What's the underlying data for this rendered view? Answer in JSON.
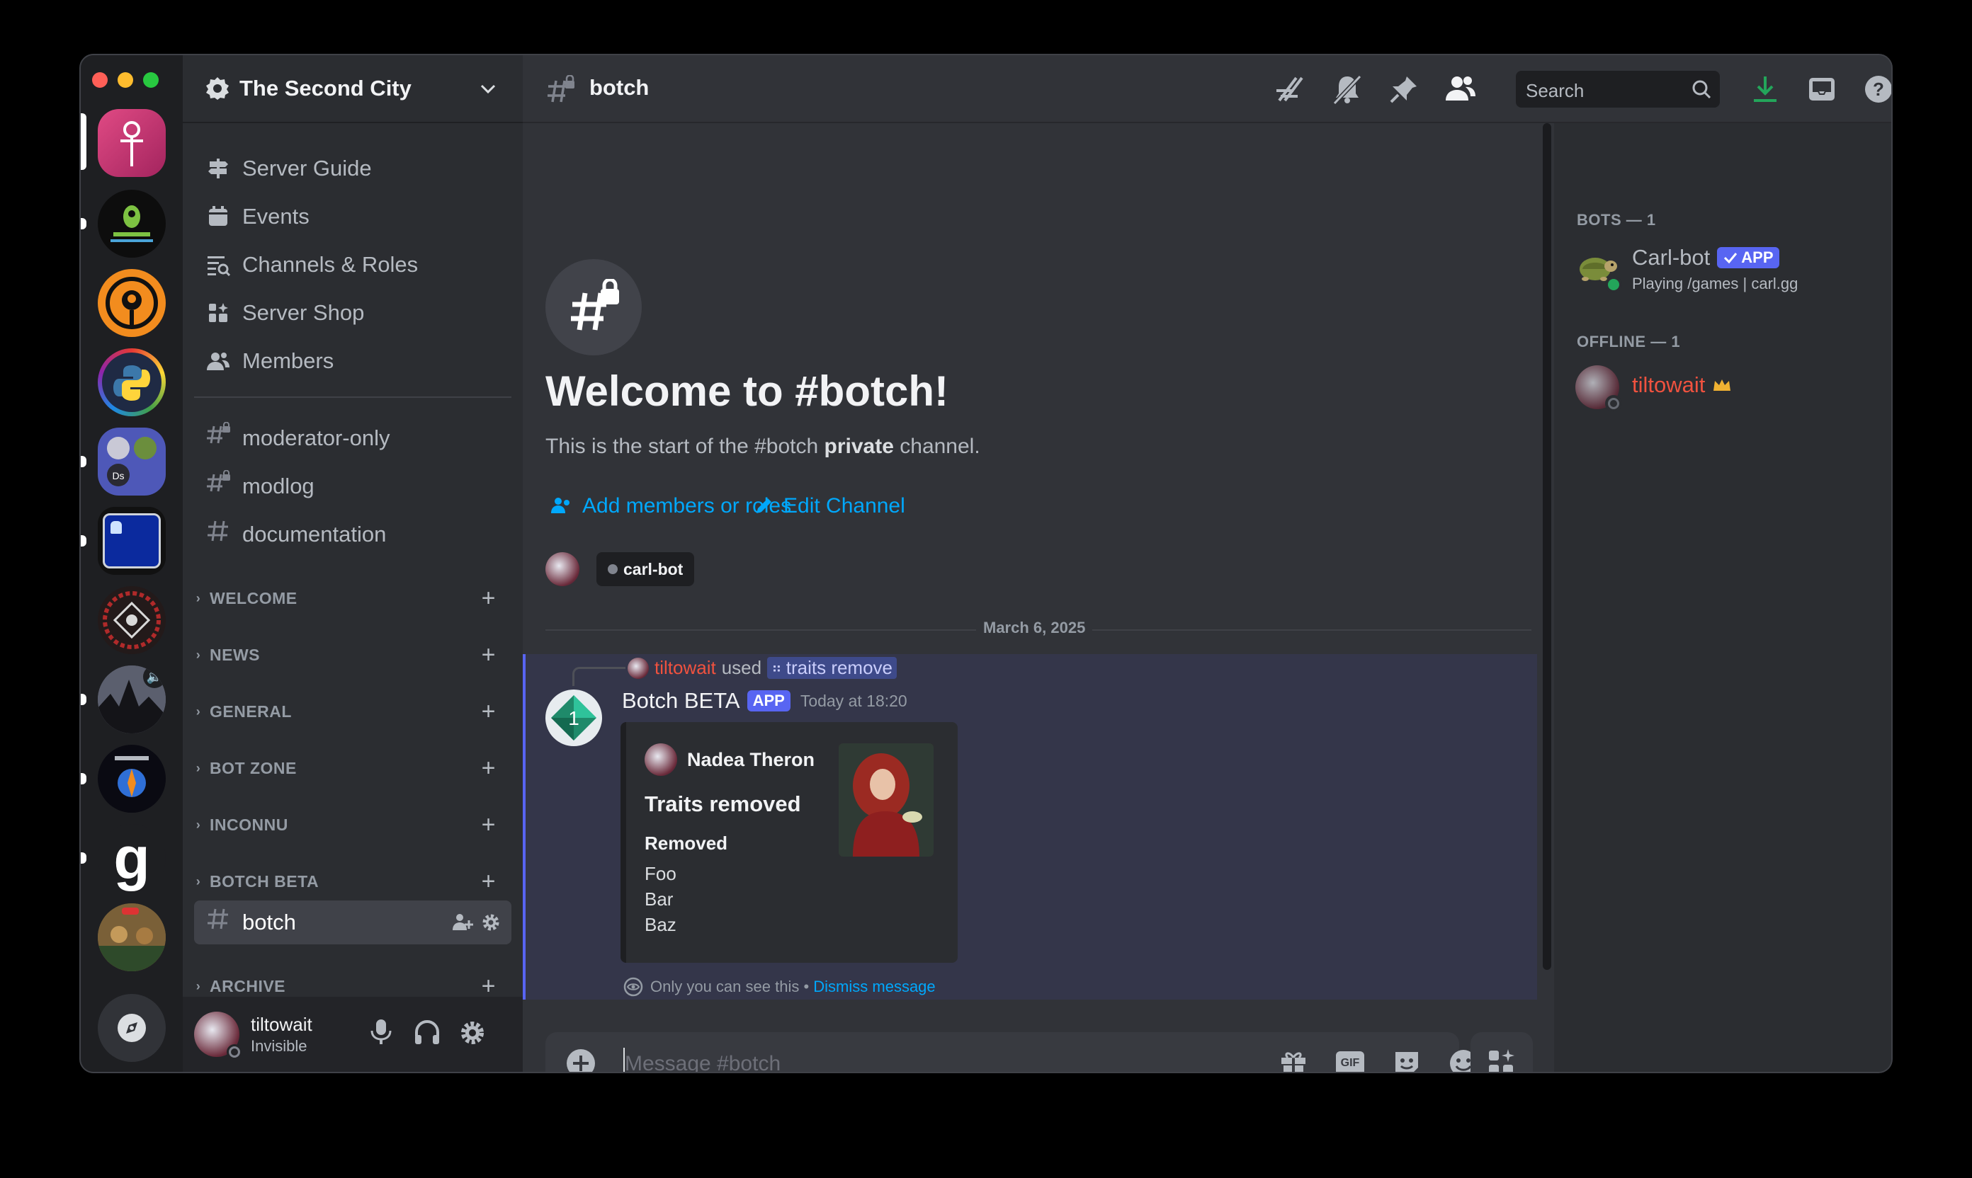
{
  "server": {
    "name": "The Second City"
  },
  "nav": [
    {
      "label": "Server Guide",
      "icon": "signpost-icon"
    },
    {
      "label": "Events",
      "icon": "calendar-icon"
    },
    {
      "label": "Channels & Roles",
      "icon": "channels-roles-icon"
    },
    {
      "label": "Server Shop",
      "icon": "shop-icon"
    },
    {
      "label": "Members",
      "icon": "members-icon"
    }
  ],
  "channels_top": [
    {
      "name": "moderator-only",
      "locked": true
    },
    {
      "name": "modlog",
      "locked": true
    },
    {
      "name": "documentation",
      "locked": false
    }
  ],
  "categories": [
    "WELCOME",
    "NEWS",
    "GENERAL",
    "BOT ZONE",
    "INCONNU",
    "BOTCH BETA",
    "ARCHIVE"
  ],
  "active_channel": {
    "name": "botch"
  },
  "user": {
    "name": "tiltowait",
    "status": "Invisible"
  },
  "header": {
    "channel": "botch",
    "search_placeholder": "Search"
  },
  "welcome": {
    "title": "Welcome to #botch!",
    "subtitle_pre": "This is the start of the #botch ",
    "subtitle_bold": "private",
    "subtitle_post": " channel.",
    "add_members": "Add members or roles",
    "edit_channel": "Edit Channel",
    "member_tag": "carl-bot"
  },
  "divider_date": "March 6, 2025",
  "message": {
    "reply_user": "tiltowait",
    "reply_used": "used",
    "reply_command": "traits remove",
    "author": "Botch BETA",
    "author_tag": "APP",
    "timestamp": "Today at 18:20",
    "embed": {
      "author": "Nadea Theron",
      "title": "Traits removed",
      "field_name": "Removed",
      "field_values": [
        "Foo",
        "Bar",
        "Baz"
      ]
    },
    "ephemeral_note": "Only you can see this",
    "ephemeral_sep": " • ",
    "dismiss": "Dismiss message"
  },
  "composer": {
    "placeholder": "Message #botch",
    "gif": "GIF"
  },
  "member_list": {
    "bots_header": "BOTS — 1",
    "bot": {
      "name": "Carl-bot",
      "tag": "APP",
      "activity": "Playing /games | carl.gg"
    },
    "offline_header": "OFFLINE — 1",
    "offline_user": {
      "name": "tiltowait"
    }
  },
  "colors": {
    "accent": "#5865f2",
    "link": "#00a8fc",
    "online": "#23a55a",
    "owner_name": "#f0523f",
    "crown": "#f0b232",
    "download": "#23a55a"
  }
}
